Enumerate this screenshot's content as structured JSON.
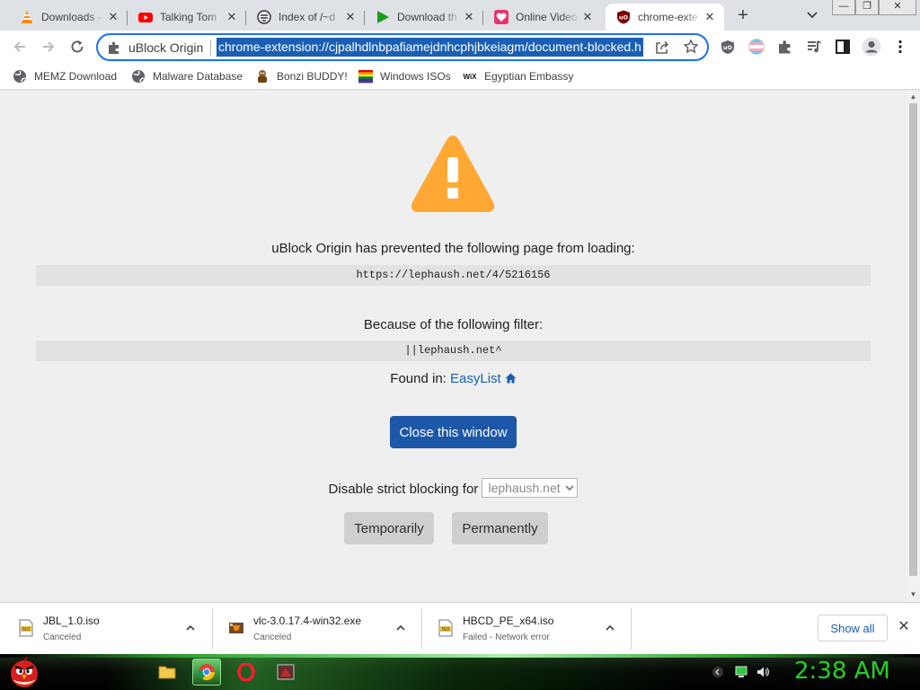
{
  "window": {
    "minimize": "—",
    "maximize": "❐",
    "close": "✕"
  },
  "tabs": [
    {
      "title": "Downloads - ",
      "icon": "vlc-cone-icon"
    },
    {
      "title": "Talking Tom ",
      "icon": "youtube-icon"
    },
    {
      "title": "Index of /~d",
      "icon": "server-icon"
    },
    {
      "title": "Download th",
      "icon": "play-triangle-icon"
    },
    {
      "title": "Online Video",
      "icon": "heart-badge-icon"
    },
    {
      "title": "chrome-exte",
      "icon": "ublock-icon",
      "active": true
    }
  ],
  "omnibox": {
    "chip": "uBlock Origin",
    "url": "chrome-extension://cjpalhdlnbpafiamejdnhcphjbkeiagm/document-blocked.h"
  },
  "bookmarks": [
    {
      "label": "MEMZ Download",
      "icon": "globe-icon"
    },
    {
      "label": "Malware Database",
      "icon": "globe-icon"
    },
    {
      "label": "Bonzi BUDDY!",
      "icon": "bonzi-icon"
    },
    {
      "label": "Windows ISOs",
      "icon": "rainbow-flag-icon"
    },
    {
      "label": "Egyptian Embassy",
      "icon": "wix-icon",
      "icon_text": "WiX"
    }
  ],
  "page": {
    "prevented_msg": "uBlock Origin has prevented the following page from loading:",
    "blocked_url": "https://lephaush.net/4/5216156",
    "filter_msg": "Because of the following filter:",
    "filter": "||lephaush.net^",
    "found_in_label": "Found in: ",
    "found_in_list": "EasyList",
    "close_button": "Close this window",
    "disable_label": "Disable strict blocking for ",
    "disable_domain": "lephaush.net",
    "temporarily": "Temporarily",
    "permanently": "Permanently",
    "warning_color": "#ffa834",
    "button_color": "#1d57a8"
  },
  "downloads": [
    {
      "name": "JBL_1.0.iso",
      "status": "Canceled",
      "icon": "iso-file-icon"
    },
    {
      "name": "vlc-3.0.17.4-win32.exe",
      "status": "Canceled",
      "icon": "exe-file-icon"
    },
    {
      "name": "HBCD_PE_x64.iso",
      "status": "Failed - Network error",
      "icon": "iso-file-icon"
    }
  ],
  "download_shelf": {
    "show_all": "Show all",
    "close": "✕"
  },
  "taskbar": {
    "apps": [
      "explorer-icon",
      "chrome-icon",
      "opera-icon",
      "app-icon"
    ],
    "clock": "2:38 AM",
    "accent": "#25d025"
  }
}
